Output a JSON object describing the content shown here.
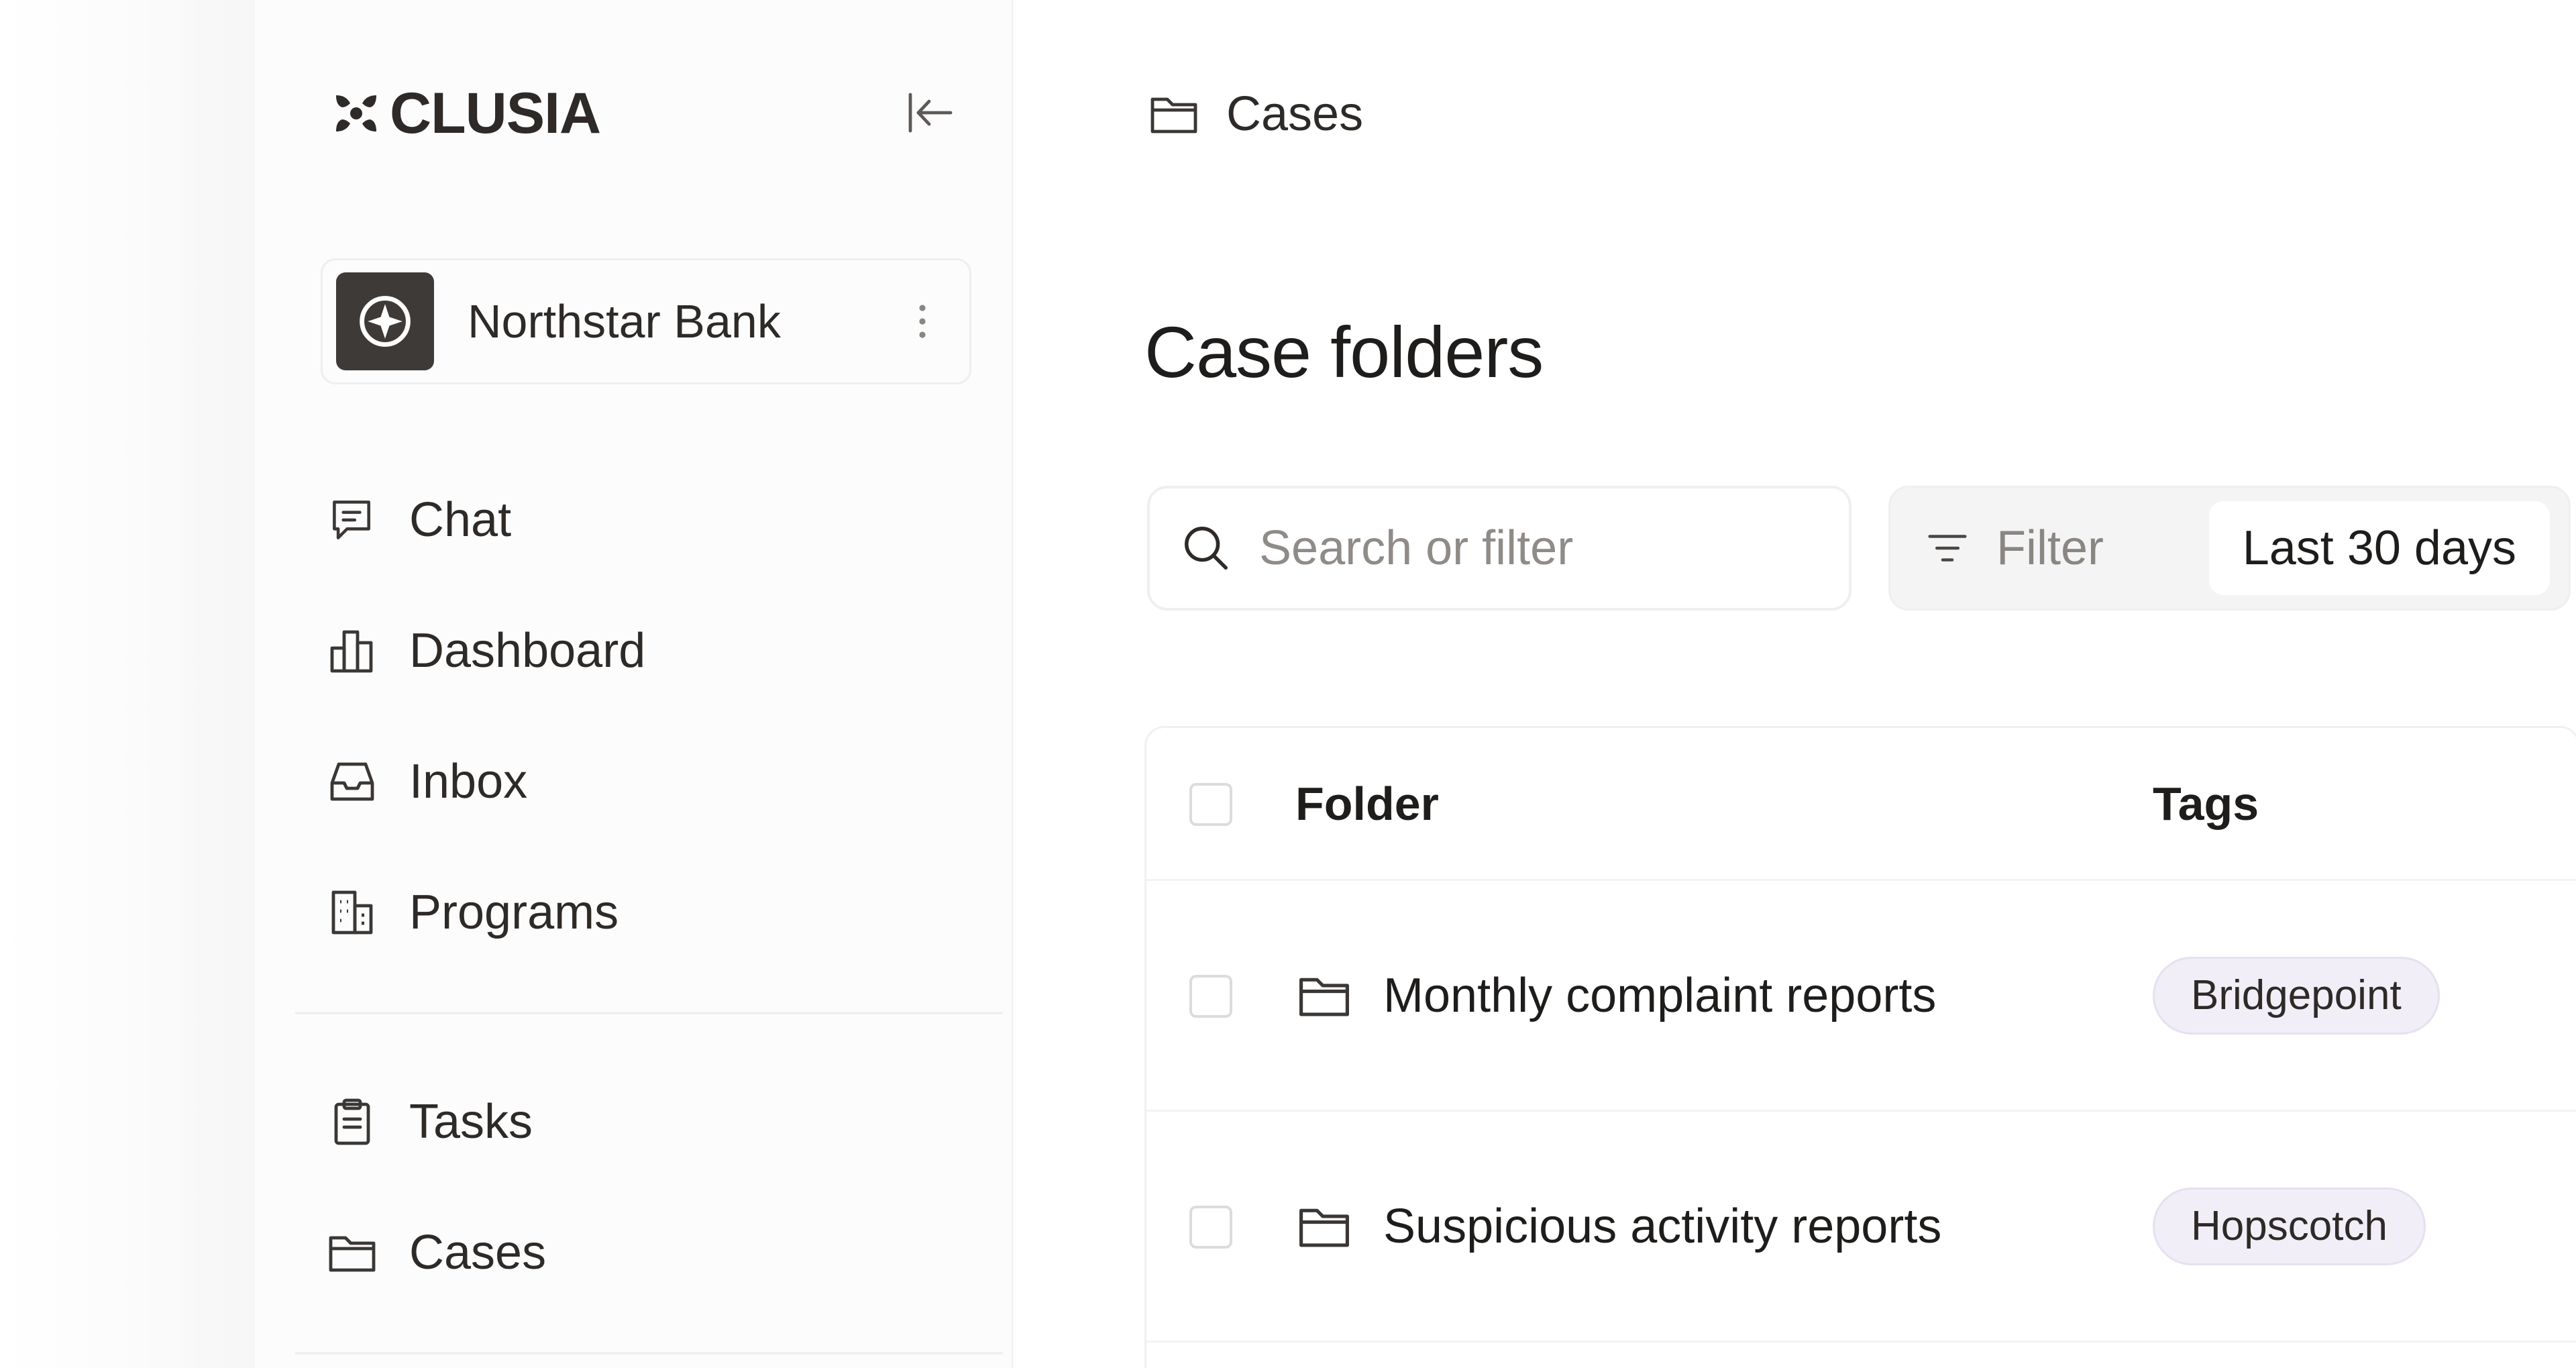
{
  "app": {
    "brand": "CLUSIA"
  },
  "sidebar": {
    "workspace": {
      "name": "Northstar Bank"
    },
    "primary_nav": [
      {
        "label": "Chat",
        "icon": "chat-icon"
      },
      {
        "label": "Dashboard",
        "icon": "bar-chart-icon"
      },
      {
        "label": "Inbox",
        "icon": "inbox-icon"
      },
      {
        "label": "Programs",
        "icon": "building-icon"
      }
    ],
    "secondary_nav": [
      {
        "label": "Tasks",
        "icon": "clipboard-icon"
      },
      {
        "label": "Cases",
        "icon": "folder-icon"
      }
    ]
  },
  "main": {
    "breadcrumb": {
      "label": "Cases",
      "icon": "folder-icon"
    },
    "title": "Case folders",
    "search": {
      "placeholder": "Search or filter",
      "value": ""
    },
    "filter": {
      "label": "Filter",
      "range": "Last 30 days"
    },
    "table": {
      "columns": [
        "Folder",
        "Tags"
      ],
      "rows": [
        {
          "folder": "Monthly complaint reports",
          "tag": "Bridgepoint"
        },
        {
          "folder": "Suspicious activity reports",
          "tag": "Hopscotch"
        }
      ]
    }
  },
  "colors": {
    "text": "#1f1d1b",
    "muted": "#8f8b87",
    "tag_bg": "#f1eef8",
    "workspace_logo_bg": "#3e3a37"
  }
}
